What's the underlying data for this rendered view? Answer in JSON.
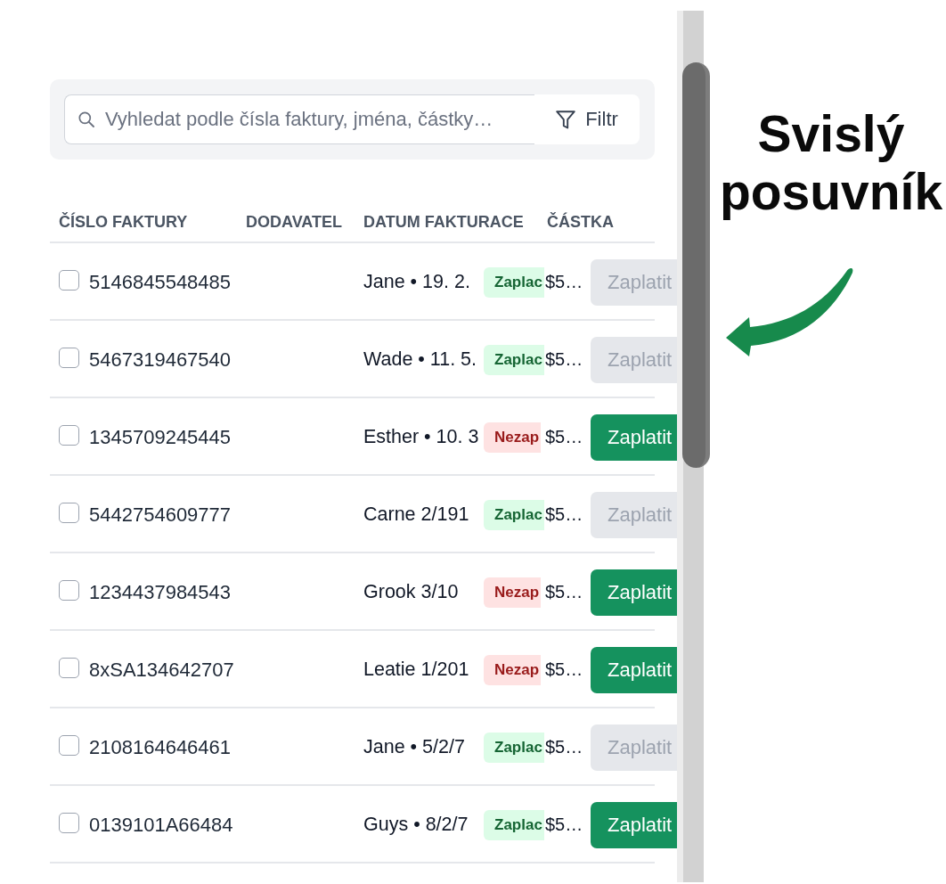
{
  "search": {
    "placeholder": "Vyhledat podle čísla faktury, jména, částky…",
    "filter_button": "Filtr"
  },
  "table": {
    "columns": [
      "ČÍSLO FAKTURY",
      "DODAVATEL",
      "DATUM FAKTURACE",
      "ČÁSTKA"
    ],
    "rows": [
      {
        "checked": false,
        "invoice_number": "5146845548485",
        "supplier_date": "Jane • 19. 2.",
        "badge": {
          "kind": "paid",
          "label": "Zaplac"
        },
        "amount": "$5…",
        "pay_button": {
          "label": "Zaplatit",
          "disabled": true
        }
      },
      {
        "checked": false,
        "invoice_number": "5467319467540",
        "supplier_date": "Wade • 11. 5.",
        "badge": {
          "kind": "paid",
          "label": "Zaplac"
        },
        "amount": "$5…",
        "pay_button": {
          "label": "Zaplatit",
          "disabled": true
        }
      },
      {
        "checked": false,
        "invoice_number": "1345709245445",
        "supplier_date": "Esther • 10. 3",
        "badge": {
          "kind": "unpaid",
          "label": "Nezap"
        },
        "amount": "$5…",
        "pay_button": {
          "label": "Zaplatit",
          "disabled": false
        }
      },
      {
        "checked": false,
        "invoice_number": "5442754609777",
        "supplier_date": "Carne 2/191",
        "badge": {
          "kind": "paid",
          "label": "Zaplac"
        },
        "amount": "$5…",
        "pay_button": {
          "label": "Zaplatit",
          "disabled": true
        }
      },
      {
        "checked": false,
        "invoice_number": "1234437984543",
        "supplier_date": "Grook 3/10",
        "badge": {
          "kind": "unpaid",
          "label": "Nezap"
        },
        "amount": "$5…",
        "pay_button": {
          "label": "Zaplatit",
          "disabled": false
        }
      },
      {
        "checked": false,
        "invoice_number": "8xSA134642707",
        "supplier_date": "Leatie 1/201",
        "badge": {
          "kind": "unpaid",
          "label": "Nezap"
        },
        "amount": "$5…",
        "pay_button": {
          "label": "Zaplatit",
          "disabled": false
        }
      },
      {
        "checked": false,
        "invoice_number": "2108164646461",
        "supplier_date": "Jane • 5/2/7",
        "badge": {
          "kind": "paid",
          "label": "Zaplac"
        },
        "amount": "$5…",
        "pay_button": {
          "label": "Zaplatit",
          "disabled": true
        }
      },
      {
        "checked": false,
        "invoice_number": "0139101A66484",
        "supplier_date": "Guys • 8/2/7",
        "badge": {
          "kind": "paid",
          "label": "Zaplac"
        },
        "amount": "$5…",
        "pay_button": {
          "label": "Zaplatit",
          "disabled": false
        }
      }
    ]
  },
  "annotation": {
    "text": "Svislý posuvník"
  }
}
